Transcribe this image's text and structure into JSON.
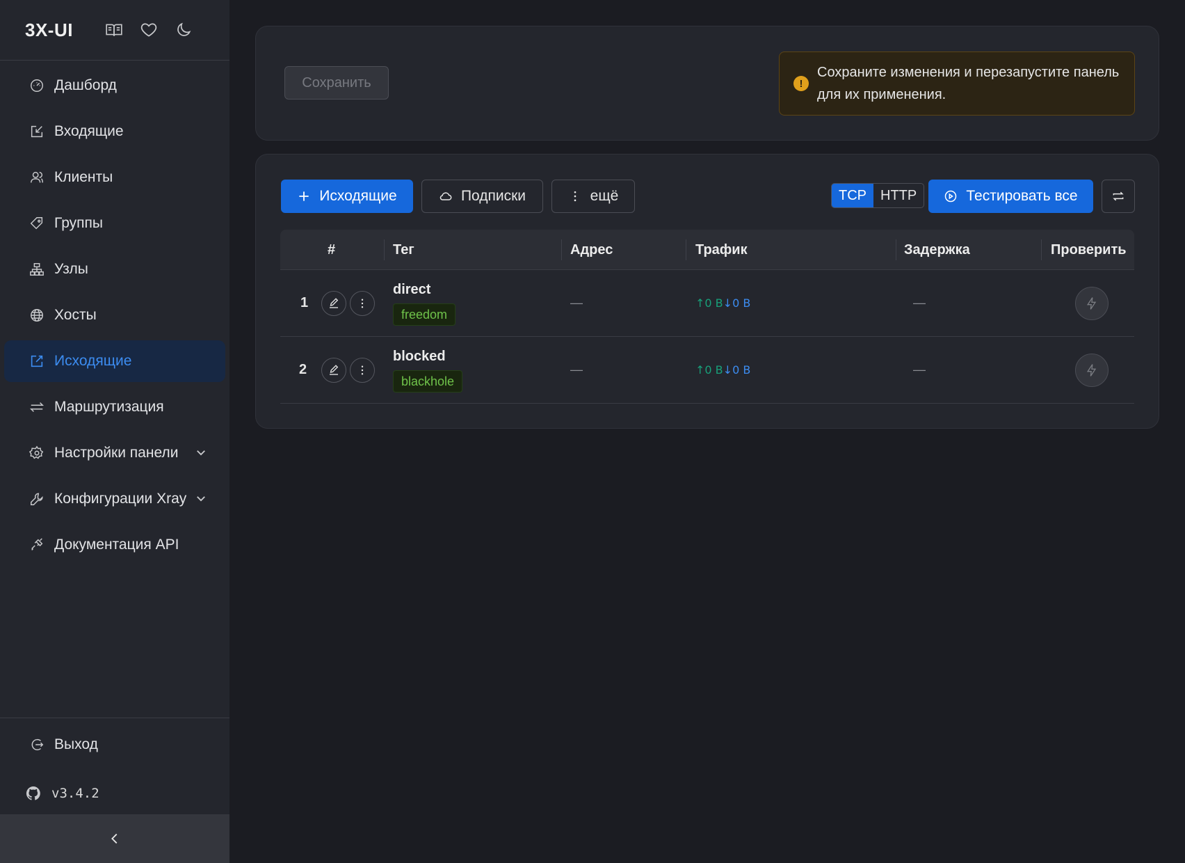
{
  "sidebar": {
    "logo": "3X-UI",
    "header_icons": [
      "book-icon",
      "heart-icon",
      "moon-icon"
    ],
    "items": [
      {
        "label": "Дашборд",
        "icon": "dashboard-icon"
      },
      {
        "label": "Входящие",
        "icon": "inbound-icon"
      },
      {
        "label": "Клиенты",
        "icon": "users-icon"
      },
      {
        "label": "Группы",
        "icon": "tag-icon"
      },
      {
        "label": "Узлы",
        "icon": "cluster-icon"
      },
      {
        "label": "Хосты",
        "icon": "globe-icon"
      },
      {
        "label": "Исходящие",
        "icon": "outbound-icon",
        "active": true
      },
      {
        "label": "Маршрутизация",
        "icon": "swap-icon"
      },
      {
        "label": "Настройки панели",
        "icon": "gear-icon",
        "expandable": true
      },
      {
        "label": "Конфигурации Xray",
        "icon": "wrench-icon",
        "expandable": true
      },
      {
        "label": "Документация API",
        "icon": "api-icon"
      }
    ],
    "logout": "Выход",
    "version": "v3.4.2"
  },
  "top_card": {
    "save_label": "Сохранить",
    "alert_text": "Сохраните изменения и перезапустите панель для их применения."
  },
  "toolbar": {
    "add_outbound": "Исходящие",
    "subscriptions": "Подписки",
    "more": "ещё",
    "mode_tcp": "TCP",
    "mode_http": "HTTP",
    "mode_selected": "TCP",
    "test_all": "Тестировать все"
  },
  "table": {
    "headers": {
      "num": "#",
      "tag": "Тег",
      "address": "Адрес",
      "traffic": "Трафик",
      "latency": "Задержка",
      "check": "Проверить"
    },
    "rows": [
      {
        "num": "1",
        "tag": "direct",
        "protocol": "freedom",
        "address": "—",
        "up": "↑0 B",
        "down": "↓0 B",
        "latency": "—"
      },
      {
        "num": "2",
        "tag": "blocked",
        "protocol": "blackhole",
        "address": "—",
        "up": "↑0 B",
        "down": "↓0 B",
        "latency": "—"
      }
    ]
  },
  "colors": {
    "accent": "#1668dc",
    "active_bg": "#172844",
    "warning": "#e0a01c",
    "badge_green": "#6fc24a"
  }
}
